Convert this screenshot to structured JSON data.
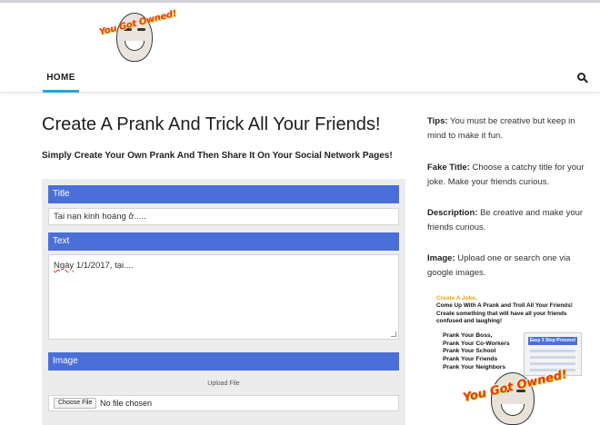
{
  "logo": {
    "text": "You Got Owned!"
  },
  "nav": {
    "home": "HOME"
  },
  "main": {
    "title": "Create A Prank And Trick All Your Friends!",
    "subtitle": "Simply Create Your Own Prank And Then Share It On Your Social Network Pages!"
  },
  "form": {
    "title_header": "Title",
    "title_value": "Tai nạn kinh hoàng ở.....",
    "text_header": "Text",
    "text_value_part1": "Ngày",
    "text_value_part2": " 1/1/2017, tại....",
    "image_header": "Image",
    "upload_label": "Upload File",
    "choose_file": "Choose File",
    "file_status": "No file chosen"
  },
  "sidebar": {
    "tips_label": "Tips:",
    "tips_text": " You must be creative but keep in mind to make it fun.",
    "fake_title_label": "Fake Title:",
    "fake_title_text": " Choose a catchy title for your joke. Make your friends curious.",
    "description_label": "Description:",
    "description_text": " Be creative and make your friends curious.",
    "image_label": "Image:",
    "image_text": " Upload one or search one via google images."
  },
  "promo": {
    "heading": "Create A Joke,",
    "line1": "Come Up With A Prank and Troll All Your Friends!",
    "line2": "Create something that will have all your friends",
    "line3": "confused and laughing!",
    "list": [
      "Prank Your Boss,",
      "Prank Your Co-Workers",
      "Prank Your School",
      "Prank Your Friends",
      "Prank Your Neighbors"
    ],
    "box_title": "Easy 3 Step Process!",
    "owned": "You Got Owned!"
  },
  "colors": {
    "accent_blue": "#4a6fd8",
    "nav_underline": "#2aa3d9",
    "owned_red": "#e03b1f"
  }
}
